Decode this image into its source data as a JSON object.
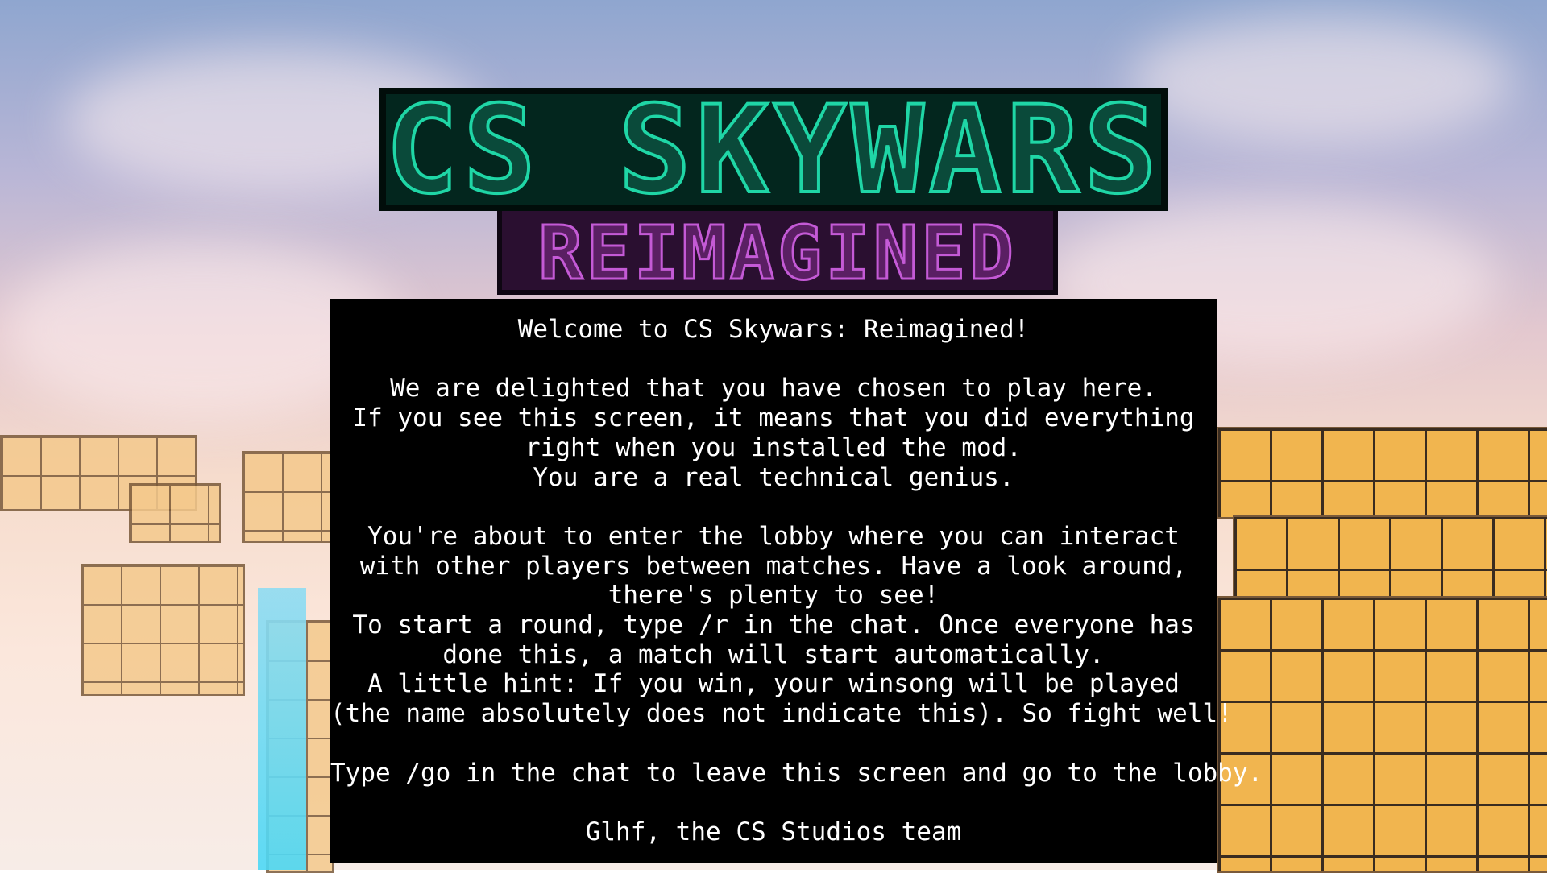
{
  "logo": {
    "title": "CS SKYWARS",
    "subtitle": "REIMAGINED",
    "colors": {
      "title_fill": "#0a4a3a",
      "title_glow": "#1fd6a6",
      "subtitle_fill": "#5a1f63",
      "subtitle_glow": "#c45ad6"
    }
  },
  "welcome": {
    "heading": "Welcome to CS Skywars: Reimagined!",
    "para1": [
      "We are delighted that you have chosen to play here.",
      "If you see this screen, it means that you did everything",
      "right when you installed the mod.",
      "You are a real technical genius."
    ],
    "para2": [
      "You're about to enter the lobby where you can interact",
      "with other players between matches. Have a look around,",
      "there's plenty to see!",
      "To start a round, type /r in the chat. Once everyone has",
      "done this, a match will start automatically.",
      "A little hint: If you win, your winsong will be played",
      "(the name absolutely does not indicate this). So fight well!"
    ],
    "instruction": "Type /go in the chat to leave this screen and go to the lobby.",
    "signoff": "Glhf, the CS Studios team"
  }
}
